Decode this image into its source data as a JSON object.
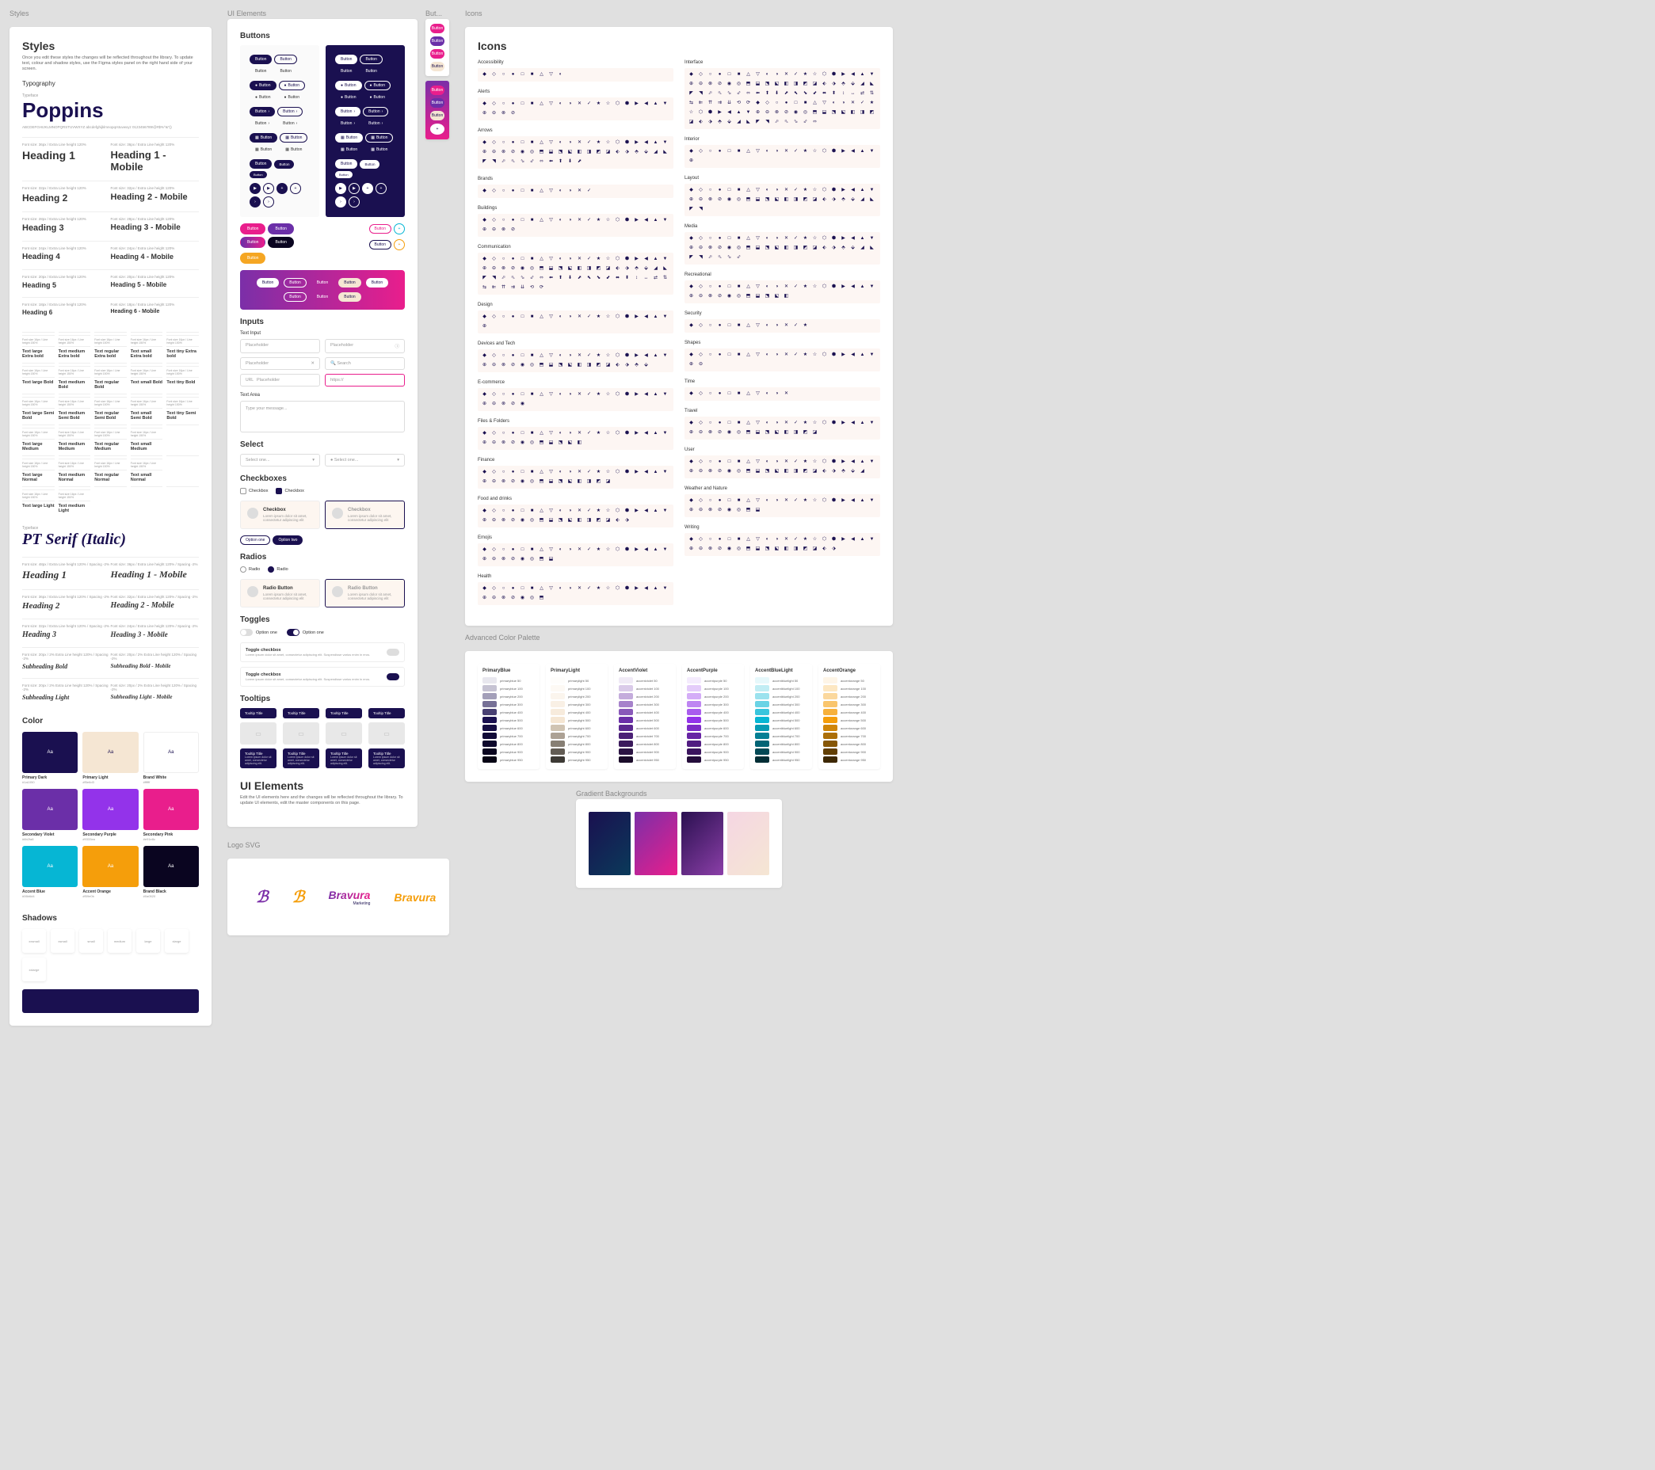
{
  "sections": {
    "styles": "Styles",
    "ui_elements": "UI Elements",
    "icons": "Icons",
    "buttons_tab": "But...",
    "advanced_palette": "Advanced Color Palette",
    "gradient_bg": "Gradient Backgrounds",
    "logo_svg": "Logo SVG"
  },
  "styles": {
    "title": "Styles",
    "desc": "Once you edit these styles the changes will be reflected throughout the library. To update text, colour and shadow styles, use the Figma styles panel on the right hand side of your screen.",
    "typography_label": "Typography",
    "typeface_label": "Typeface",
    "typeface": "Poppins",
    "alphabet": "ABCDEFGHIJKLMNOPQRSTUVWXYZ abcdefghijklmnopqrstuvwxyz 0123456789!@#$%^&*()",
    "headings": [
      {
        "meta": "Font size: 36px / Extra Line height 120%",
        "name": "Heading 1"
      },
      {
        "meta": "Font size: 32px / Extra Line height 120%",
        "name": "Heading 2"
      },
      {
        "meta": "Font size: 28px / Extra Line height 120%",
        "name": "Heading 3"
      },
      {
        "meta": "Font size: 24px / Extra Line height 120%",
        "name": "Heading 4"
      },
      {
        "meta": "Font size: 20px / Extra Line height 120%",
        "name": "Heading 5"
      },
      {
        "meta": "Font size: 18px / Extra Line height 120%",
        "name": "Heading 6"
      }
    ],
    "headings_mobile": [
      {
        "meta": "Font size: 36px / Extra Line height 120%",
        "name": "Heading 1 - Mobile"
      },
      {
        "meta": "Font size: 32px / Extra Line height 120%",
        "name": "Heading 2 - Mobile"
      },
      {
        "meta": "Font size: 28px / Extra Line height 120%",
        "name": "Heading 3 - Mobile"
      },
      {
        "meta": "Font size: 24px / Extra Line height 120%",
        "name": "Heading 4 - Mobile"
      },
      {
        "meta": "Font size: 20px / Extra Line height 120%",
        "name": "Heading 5 - Mobile"
      },
      {
        "meta": "Font size: 18px / Extra Line height 120%",
        "name": "Heading 6 - Mobile"
      }
    ],
    "text_styles_meta": "Font size 16px / Line height 150%",
    "text_styles": [
      "Text large Extra bold",
      "Text medium Extra bold",
      "Text regular Extra bold",
      "Text small Extra bold",
      "Text tiny Extra bold",
      "Text large Bold",
      "Text medium Bold",
      "Text regular Bold",
      "Text small Bold",
      "Text tiny Bold",
      "Text large Semi Bold",
      "Text medium Semi Bold",
      "Text regular Semi Bold",
      "Text small Semi Bold",
      "Text tiny Semi Bold",
      "Text large Medium",
      "Text medium Medium",
      "Text regular Medium",
      "Text small Medium",
      "",
      "Text large Normal",
      "Text medium Normal",
      "Text regular Normal",
      "Text small Normal",
      "",
      "Text large Light",
      "Text medium Light",
      "",
      "",
      ""
    ],
    "ptserif_label": "Typeface",
    "ptserif": "PT Serif (Italic)",
    "ptserif_headings": [
      {
        "meta": "Font size: 48px / Extra Line height 120% / Spacing -2%",
        "name": "Heading 1"
      },
      {
        "meta": "Font size: 36px / Extra Line height 120% / Spacing -2%",
        "name": "Heading 2"
      },
      {
        "meta": "Font size: 32px / Extra Line height 120% / Spacing -2%",
        "name": "Heading 3"
      },
      {
        "meta": "Font size: 20px / 2% Extra Line height 120% / Spacing -2%",
        "name": "Subheading Bold"
      },
      {
        "meta": "Font size: 20px / 2% Extra Line height 120% / Spacing -2%",
        "name": "Subheading Light"
      }
    ],
    "ptserif_headings_mobile": [
      {
        "meta": "Font size: 36px / Extra Line height 120% / Spacing -2%",
        "name": "Heading 1 - Mobile"
      },
      {
        "meta": "Font size: 32px / Extra Line height 120% / Spacing -2%",
        "name": "Heading 2 - Mobile"
      },
      {
        "meta": "Font size: 24px / Extra Line height 120% / Spacing -2%",
        "name": "Heading 3 - Mobile"
      },
      {
        "meta": "Font size: 20px / 2% Extra Line height 120% / Spacing -2%",
        "name": "Subheading Bold - Mobile"
      },
      {
        "meta": "Font size: 20px / 2% Extra Line height 120% / Spacing -2%",
        "name": "Subheading Light - Mobile"
      }
    ],
    "color_label": "Color",
    "colors": [
      {
        "name": "Primary Dark",
        "hex": "#1a1050",
        "label": "Aa",
        "fg": "#fff"
      },
      {
        "name": "Primary Light",
        "hex": "#f5e6d3",
        "label": "Aa",
        "fg": "#1a1050"
      },
      {
        "name": "Brand White",
        "hex": "#ffffff",
        "label": "Aa",
        "fg": "#1a1050"
      },
      {
        "name": "Secondary Violet",
        "hex": "#6b2fa8",
        "label": "Aa",
        "fg": "#fff"
      },
      {
        "name": "Secondary Purple",
        "hex": "#9333ea",
        "label": "Aa",
        "fg": "#fff"
      },
      {
        "name": "Secondary Pink",
        "hex": "#e91e8c",
        "label": "Aa",
        "fg": "#fff"
      },
      {
        "name": "Accent Blue",
        "hex": "#06b6d4",
        "label": "Aa",
        "fg": "#fff"
      },
      {
        "name": "Accent Orange",
        "hex": "#f59e0b",
        "label": "Aa",
        "fg": "#fff"
      },
      {
        "name": "Brand Black",
        "hex": "#0a0520",
        "label": "Aa",
        "fg": "#fff"
      }
    ],
    "shadows_label": "Shadows",
    "shadows": [
      "xxsmall",
      "xsmall",
      "small",
      "medium",
      "large",
      "xlarge",
      "xxlarge"
    ]
  },
  "ui": {
    "buttons_label": "Buttons",
    "button_text": "Button",
    "inputs_label": "Inputs",
    "text_input_label": "Text Input",
    "input_placeholder": "Placeholder",
    "input_search": "Search",
    "input_https": "https://",
    "text_area_label": "Text Area",
    "textarea_placeholder": "Type your message...",
    "select_label": "Select",
    "select_placeholder": "Select one...",
    "checkboxes_label": "Checkboxes",
    "checkbox_text": "Checkbox",
    "checkbox_desc": "Lorem ipsum dolor sit amet, consectetur adipiscing elit",
    "option_one": "Option one",
    "option_two": "Option two",
    "radios_label": "Radios",
    "radio_text": "Radio",
    "radio_button": "Radio Button",
    "toggles_label": "Toggles",
    "toggle_text": "Option one",
    "toggle_checkbox": "Toggle checkbox",
    "toggle_desc": "Lorem ipsum dolor sit amet, consectetur adipiscing elit. Suspendisse varius enim in eros.",
    "tooltips_label": "Tooltips",
    "tooltip_title": "Tooltip Title",
    "tooltip_desc": "Lorem ipsum dolor sit amet, consectetur adipiscing elit.",
    "ui_elements_title": "UI Elements",
    "ui_elements_desc": "Edit the UI elements here and the changes will be reflected throughout the library. To update UI elements, edit the master components on this page."
  },
  "icons": {
    "title": "Icons",
    "categories_left": [
      "Accessibility",
      "Alerts",
      "Arrows",
      "Brands",
      "Buildings",
      "Communication",
      "Design",
      "Devices and Tech",
      "E-commerce",
      "Files & Folders",
      "Finance",
      "Food and drinks",
      "Emojis",
      "Health"
    ],
    "categories_right": [
      "Interface",
      "Interior",
      "Layout",
      "Media",
      "Recreational",
      "Security",
      "Shapes",
      "Time",
      "Travel",
      "User",
      "Weather and Nature",
      "Writing"
    ],
    "icon_counts_left": [
      9,
      24,
      51,
      12,
      24,
      67,
      21,
      38,
      25,
      31,
      34,
      36,
      28,
      27
    ],
    "icon_counts_right": [
      114,
      21,
      42,
      46,
      31,
      13,
      22,
      11,
      34,
      39,
      28,
      36
    ]
  },
  "palette": {
    "groups": [
      {
        "name": "PrimaryBlue",
        "base": "#1a1050",
        "shades": [
          "primaryblue 50",
          "primaryblue 100",
          "primaryblue 200",
          "primaryblue 300",
          "primaryblue 400",
          "primaryblue 500",
          "primaryblue 600",
          "primaryblue 700",
          "primaryblue 800",
          "primaryblue 900",
          "primaryblue 950"
        ]
      },
      {
        "name": "PrimaryLight",
        "base": "#f5e6d3",
        "shades": [
          "primarylight 50",
          "primarylight 100",
          "primarylight 200",
          "primarylight 300",
          "primarylight 400",
          "primarylight 500",
          "primarylight 600",
          "primarylight 700",
          "primarylight 800",
          "primarylight 900",
          "primarylight 950"
        ]
      },
      {
        "name": "AccentViolet",
        "base": "#6b2fa8",
        "shades": [
          "accentviolet 50",
          "accentviolet 100",
          "accentviolet 200",
          "accentviolet 300",
          "accentviolet 400",
          "accentviolet 500",
          "accentviolet 600",
          "accentviolet 700",
          "accentviolet 800",
          "accentviolet 900",
          "accentviolet 950"
        ]
      },
      {
        "name": "AccentPurple",
        "base": "#9333ea",
        "shades": [
          "accentpurple 50",
          "accentpurple 100",
          "accentpurple 200",
          "accentpurple 300",
          "accentpurple 400",
          "accentpurple 500",
          "accentpurple 600",
          "accentpurple 700",
          "accentpurple 800",
          "accentpurple 900",
          "accentpurple 950"
        ]
      },
      {
        "name": "AccentBlueLight",
        "base": "#06b6d4",
        "shades": [
          "accentbluelight 50",
          "accentbluelight 100",
          "accentbluelight 200",
          "accentbluelight 300",
          "accentbluelight 400",
          "accentbluelight 500",
          "accentbluelight 600",
          "accentbluelight 700",
          "accentbluelight 800",
          "accentbluelight 900",
          "accentbluelight 950"
        ]
      },
      {
        "name": "AccentOrange",
        "base": "#f59e0b",
        "shades": [
          "accentorange 50",
          "accentorange 100",
          "accentorange 200",
          "accentorange 300",
          "accentorange 400",
          "accentorange 500",
          "accentorange 600",
          "accentorange 700",
          "accentorange 800",
          "accentorange 900",
          "accentorange 950"
        ]
      }
    ]
  },
  "gradients": [
    "linear-gradient(135deg,#1a1050,#0a3a5a)",
    "linear-gradient(135deg,#7b2fa8,#e91e8c)",
    "linear-gradient(135deg,#2a1050,#8b3fa8)",
    "linear-gradient(135deg,#f5d6e3,#f5e6d3)"
  ],
  "logos": {
    "brand": "Bravura",
    "tagline": "Marketing"
  }
}
